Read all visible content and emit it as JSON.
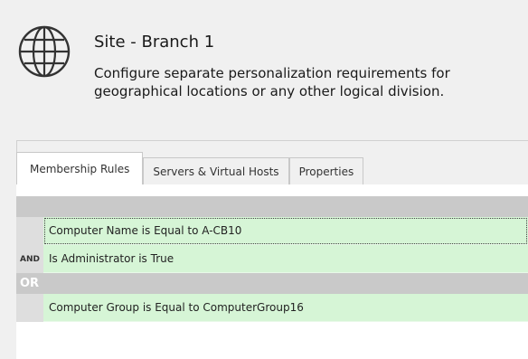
{
  "site": {
    "title": "Site - Branch 1",
    "description_line1": "Configure separate personalization requirements for",
    "description_line2": "geographical locations or any other logical division."
  },
  "tabs": [
    {
      "label": "Membership Rules",
      "active": true
    },
    {
      "label": "Servers & Virtual Hosts",
      "active": false
    },
    {
      "label": "Properties",
      "active": false
    }
  ],
  "rules": {
    "group1": [
      {
        "operator": "",
        "text": "Computer Name is Equal to A-CB10",
        "selected": true
      },
      {
        "operator": "AND",
        "text": "Is Administrator is True",
        "selected": false
      }
    ],
    "or_label": "OR",
    "group2": [
      {
        "operator": "",
        "text": "Computer Group is Equal to ComputerGroup16",
        "selected": false
      }
    ]
  },
  "colors": {
    "rule_bg": "#d6f5d6",
    "group_header_bg": "#c9c9c9"
  },
  "icons": {
    "site": "globe-icon"
  }
}
